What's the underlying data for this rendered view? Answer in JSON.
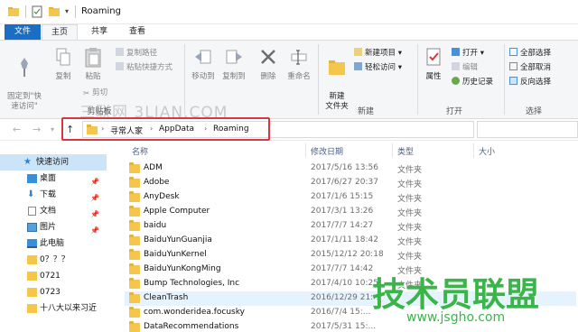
{
  "window": {
    "title": "Roaming",
    "quick_access_dropdown": "▾"
  },
  "tabs": [
    {
      "label": "文件"
    },
    {
      "label": "主页"
    },
    {
      "label": "共享"
    },
    {
      "label": "查看"
    }
  ],
  "ribbon": {
    "clipboard": {
      "pin_label": "固定到\"快\n速访问\"",
      "copy_label": "复制",
      "paste_label": "粘贴",
      "copy_path_label": "复制路径",
      "paste_shortcut_label": "粘贴快捷方式",
      "cut_label": "剪切",
      "group_label": "剪贴板"
    },
    "organize": {
      "move_to_label": "移动到",
      "copy_to_label": "复制到",
      "delete_label": "删除",
      "rename_label": "重命名"
    },
    "new": {
      "new_folder_label": "新建\n文件夹",
      "new_item_label": "新建项目 ▾",
      "easy_access_label": "轻松访问 ▾",
      "group_label": "新建"
    },
    "open": {
      "properties_label": "属性",
      "open_label": "打开 ▾",
      "edit_label": "编辑",
      "history_label": "历史记录",
      "group_label": "打开"
    },
    "select": {
      "select_all_label": "全部选择",
      "select_none_label": "全部取消",
      "invert_label": "反向选择",
      "group_label": "选择"
    }
  },
  "address": {
    "crumbs": [
      "寻常人家",
      "AppData",
      "Roaming"
    ],
    "sep": "›"
  },
  "sidebar": {
    "items": [
      {
        "label": "快速访问",
        "icon": "star-icon"
      },
      {
        "label": "桌面",
        "icon": "desktop-icon"
      },
      {
        "label": "下载",
        "icon": "download-icon"
      },
      {
        "label": "文档",
        "icon": "document-icon"
      },
      {
        "label": "图片",
        "icon": "picture-icon"
      },
      {
        "label": "此电脑",
        "icon": "computer-icon"
      },
      {
        "label": "0？？？",
        "icon": "folder-icon"
      },
      {
        "label": "0721",
        "icon": "folder-icon"
      },
      {
        "label": "0723",
        "icon": "folder-icon"
      },
      {
        "label": "十八大以来习近",
        "icon": "folder-icon"
      }
    ]
  },
  "columns": {
    "name": "名称",
    "date": "修改日期",
    "type": "类型",
    "size": "大小"
  },
  "files": [
    {
      "name": "ADM",
      "date": "2017/5/16 13:56",
      "type": "文件夹"
    },
    {
      "name": "Adobe",
      "date": "2017/6/27 20:37",
      "type": "文件夹"
    },
    {
      "name": "AnyDesk",
      "date": "2017/1/6 15:15",
      "type": "文件夹"
    },
    {
      "name": "Apple Computer",
      "date": "2017/3/1 13:26",
      "type": "文件夹"
    },
    {
      "name": "baidu",
      "date": "2017/7/7 14:27",
      "type": "文件夹"
    },
    {
      "name": "BaiduYunGuanjia",
      "date": "2017/1/11 18:42",
      "type": "文件夹"
    },
    {
      "name": "BaiduYunKernel",
      "date": "2015/12/12 20:18",
      "type": "文件夹"
    },
    {
      "name": "BaiduYunKongMing",
      "date": "2017/7/7 14:42",
      "type": "文件夹"
    },
    {
      "name": "Bump Technologies, Inc",
      "date": "2017/4/10 10:25",
      "type": "文件夹"
    },
    {
      "name": "CleanTrash",
      "date": "2016/12/29 21:...",
      "type": ""
    },
    {
      "name": "com.wonderidea.focusky",
      "date": "2016/7/4 15:...",
      "type": ""
    },
    {
      "name": "DataRecommendations",
      "date": "2017/5/31 15:...",
      "type": ""
    }
  ],
  "watermarks": {
    "top": "三联网 3LIAN.COM",
    "brand": "技术员联盟",
    "url": "www.jsgho.com"
  },
  "colors": {
    "file_tab": "#1a6fc4",
    "highlight": "#d9363e",
    "folder": "#f5c64c",
    "brand": "#3ab54a"
  }
}
